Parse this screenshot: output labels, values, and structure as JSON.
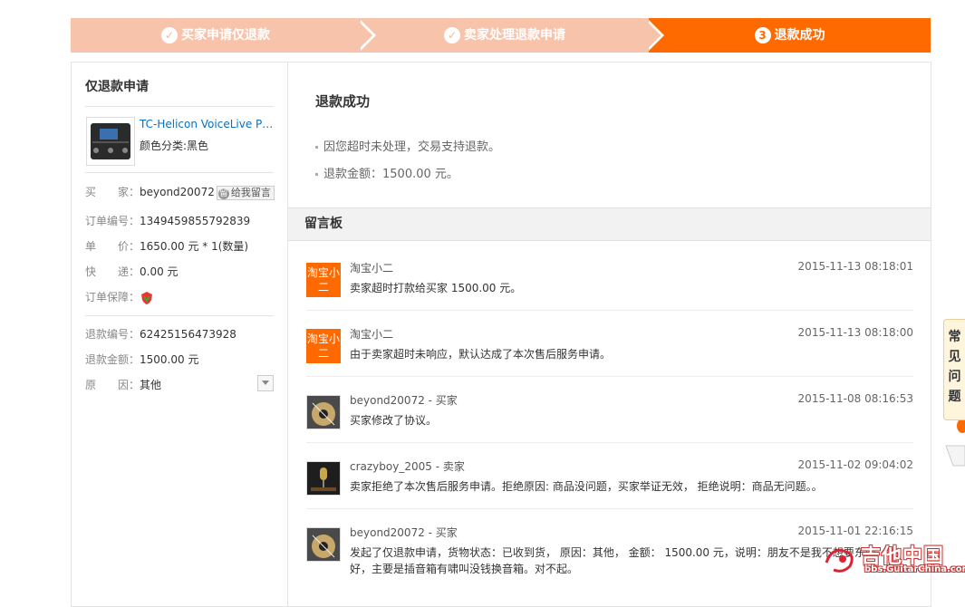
{
  "steps": {
    "step1": "买家申请仅退款",
    "step2": "卖家处理退款申请",
    "step3_num": "3",
    "step3": "退款成功"
  },
  "left": {
    "title": "仅退款申请",
    "product_name": "TC-Helicon VoiceLive Pla...",
    "product_attr": "颜色分类:黑色",
    "buyer_label": "买　　家：",
    "buyer_value": "beyond20072",
    "leave_msg_button": "给我留言",
    "order_label": "订单编号：",
    "order_value": "1349459855792839",
    "price_label": "单　　价：",
    "price_value": "1650.00",
    "price_unit": "元 * 1(数量)",
    "shipping_label": "快　　递：",
    "shipping_value": "0.00",
    "shipping_unit": "元",
    "guarantee_label": "订单保障：",
    "refund_no_label": "退款编号：",
    "refund_no_value": "62425156473928",
    "refund_amount_label": "退款金额：",
    "refund_amount_value": "1500.00",
    "refund_amount_unit": "元",
    "reason_label": "原　　因：",
    "reason_value": "其他"
  },
  "main": {
    "title": "退款成功",
    "bullet1": "因您超时未处理，交易支持退款。",
    "bullet2": "退款金额：1500.00 元。",
    "board_title": "留言板"
  },
  "messages": [
    {
      "avatar_text": "淘宝小二",
      "who": "淘宝小二",
      "time": "2015-11-13 08:18:01",
      "text": "卖家超时打款给买家 1500.00 元。"
    },
    {
      "avatar_text": "淘宝小二",
      "who": "淘宝小二",
      "time": "2015-11-13 08:18:00",
      "text": "由于卖家超时未响应，默认达成了本次售后服务申请。"
    },
    {
      "who": "beyond20072 - 买家",
      "time": "2015-11-08 08:16:53",
      "text": "买家修改了协议。"
    },
    {
      "who": "crazyboy_2005 - 卖家",
      "time": "2015-11-02 09:04:02",
      "text": "卖家拒绝了本次售后服务申请。拒绝原因: 商品没问题，买家举证无效， 拒绝说明：商品无问题。。"
    },
    {
      "who": "beyond20072 - 买家",
      "time": "2015-11-01 22:16:15",
      "text": "发起了仅退款申请，货物状态：已收到货， 原因：其他， 金额： 1500.00 元，说明：朋友不是我不想要东西好，主要是插音箱有啸叫没钱换音箱。对不起。"
    }
  ],
  "side": {
    "faq": "常见问题"
  },
  "watermark": {
    "text": "吉他中国",
    "url": "bbs.GuitarChina.com"
  },
  "colors": {
    "accent": "#ff6a00",
    "step_done": "#f8c3ab",
    "link": "#0a6fbf"
  }
}
